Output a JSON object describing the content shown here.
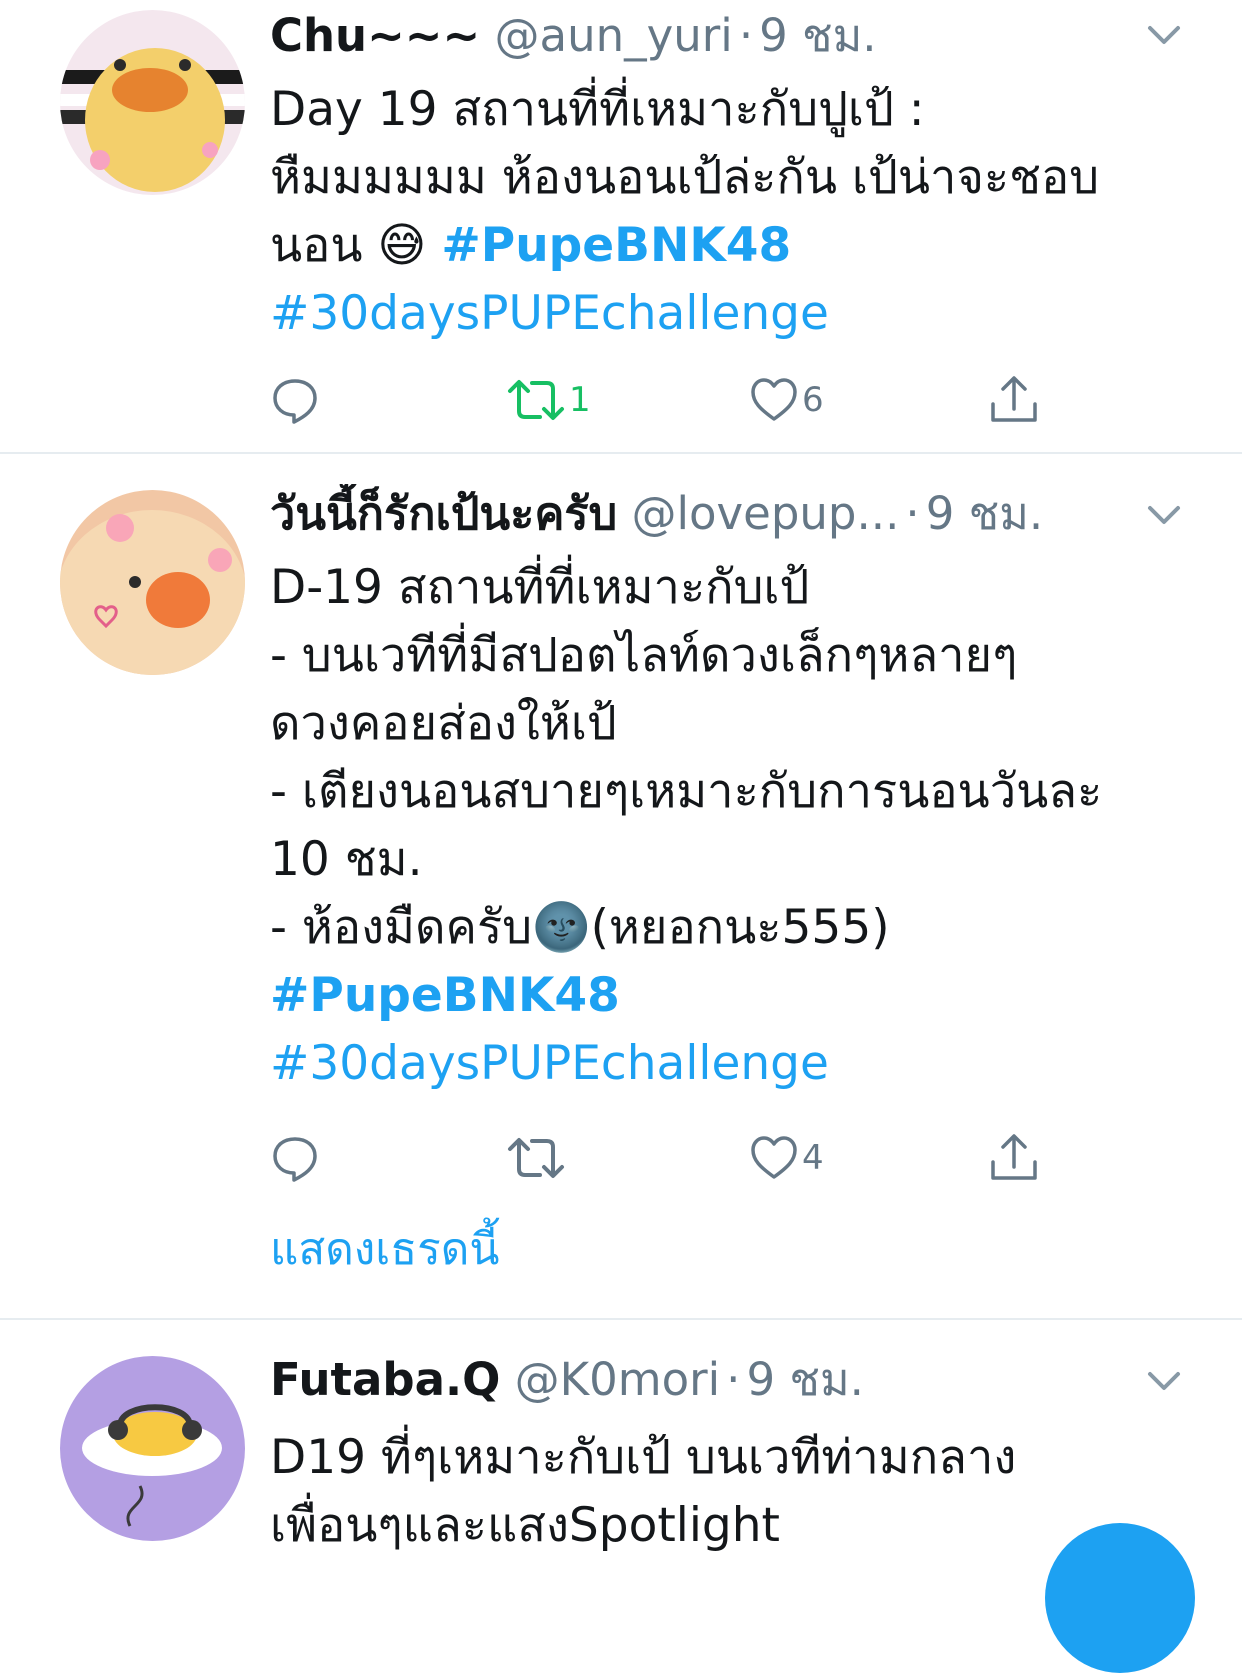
{
  "tweets": [
    {
      "name": "Chu~~~",
      "handle": "@aun_yuri",
      "time": "9 ชม.",
      "lines": [
        "Day 19 สถานที่ที่เหมาะกับปูเป้ :",
        "หืมมมมมม ห้องนอนเป้ล่ะกัน เป้น่าจะชอบ",
        "นอน 😅"
      ],
      "hashtag_inline": "#PupeBNK48",
      "hashtag2": "#30daysPUPEchallenge",
      "retweets": "1",
      "likes": "6"
    },
    {
      "name": "วันนี้ก็รักเป้นะครับ",
      "handle": "@lovepup...",
      "time": "9 ชม.",
      "lines": [
        "D-19 สถานที่ที่เหมาะกับเป้",
        "- บนเวทีที่มีสปอตไลท์ดวงเล็กๆหลายๆ",
        "ดวงคอยส่องให้เป้",
        "- เตียงนอนสบายๆเหมาะกับการนอนวันละ",
        "10 ชม.",
        "- ห้องมืดครับ🌚(หยอกนะ555)"
      ],
      "hashtag1": "#PupeBNK48",
      "hashtag2": "#30daysPUPEchallenge",
      "likes": "4",
      "show_thread": "แสดงเธรดนี้"
    },
    {
      "name": "Futaba.Q",
      "handle": "@K0mori",
      "time": "9 ชม.",
      "lines": [
        "D19 ที่ๆเหมาะกับเป้ บนเวทีท่ามกลาง",
        "เพื่อนๆและแสงSpotlight"
      ]
    }
  ],
  "colors": {
    "link": "#1da1f2",
    "secondary": "#657786",
    "retweet_green": "#17bf63",
    "divider": "#e6ecf0"
  },
  "icons": [
    "reply-icon",
    "retweet-icon",
    "like-icon",
    "share-icon",
    "chevron-down-icon",
    "compose-fab"
  ]
}
